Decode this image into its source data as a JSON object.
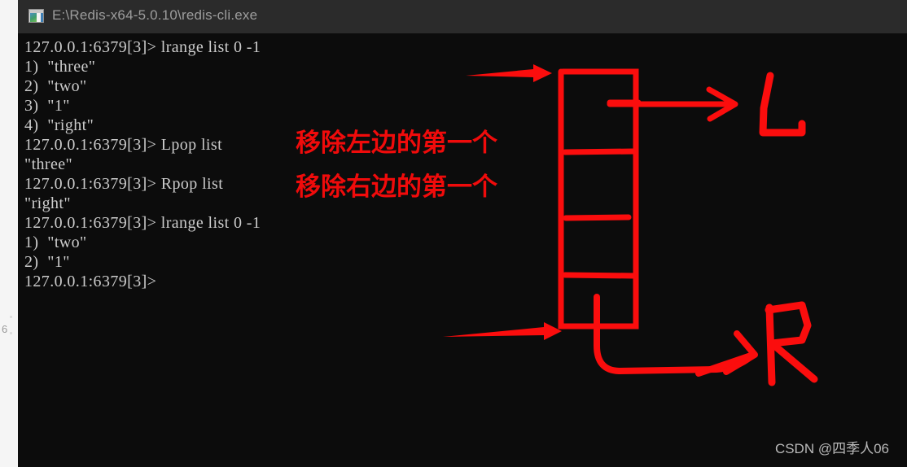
{
  "window": {
    "title": "E:\\Redis-x64-5.0.10\\redis-cli.exe",
    "icon": "console-app-icon"
  },
  "page_strip": {
    "number": "6"
  },
  "terminal": {
    "prompt": "127.0.0.1:6379[3]>",
    "lines": [
      "127.0.0.1:6379[3]> lrange list 0 -1",
      "1)  \"three\"",
      "2)  \"two\"",
      "3)  \"1\"",
      "4)  \"right\"",
      "127.0.0.1:6379[3]> Lpop list",
      "\"three\"",
      "127.0.0.1:6379[3]> Rpop list",
      "\"right\"",
      "127.0.0.1:6379[3]> lrange list 0 -1",
      "1)  \"two\"",
      "2)  \"1\"",
      "127.0.0.1:6379[3]>"
    ]
  },
  "annotations": {
    "note_left": "移除左边的第一个",
    "note_right": "移除右边的第一个",
    "label_top": "L",
    "label_bottom": "R",
    "color": "#fb0d0d"
  },
  "watermark": {
    "text": "CSDN @四季人06"
  }
}
